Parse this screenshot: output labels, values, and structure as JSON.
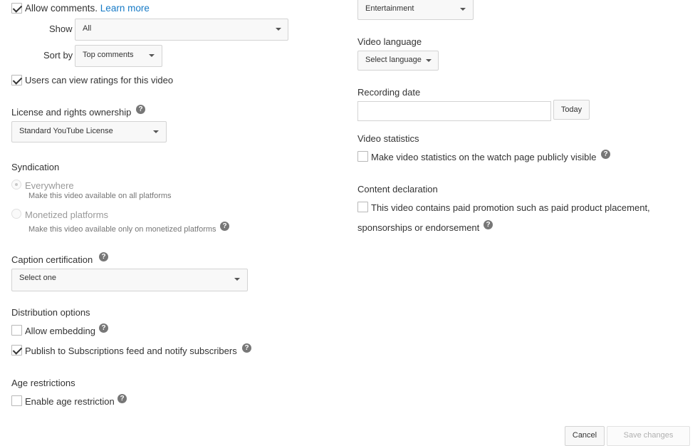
{
  "comments": {
    "allow_label": "Allow comments.",
    "learn_more": "Learn more",
    "show_label": "Show",
    "show_value": "All",
    "sort_label": "Sort by",
    "sort_value": "Top comments"
  },
  "ratings": {
    "label": "Users can view ratings for this video"
  },
  "license": {
    "heading": "License and rights ownership",
    "value": "Standard YouTube License"
  },
  "syndication": {
    "heading": "Syndication",
    "everywhere_label": "Everywhere",
    "everywhere_desc": "Make this video available on all platforms",
    "monetized_label": "Monetized platforms",
    "monetized_desc": "Make this video available only on monetized platforms"
  },
  "caption": {
    "heading": "Caption certification",
    "value": "Select one"
  },
  "distribution": {
    "heading": "Distribution options",
    "embedding_label": "Allow embedding",
    "publish_label": "Publish to Subscriptions feed and notify subscribers"
  },
  "age": {
    "heading": "Age restrictions",
    "label": "Enable age restriction"
  },
  "category": {
    "value": "Entertainment"
  },
  "video_language": {
    "heading": "Video language",
    "value": "Select language"
  },
  "recording_date": {
    "heading": "Recording date",
    "value": "",
    "today_button": "Today"
  },
  "video_statistics": {
    "heading": "Video statistics",
    "label": "Make video statistics on the watch page publicly visible"
  },
  "content_declaration": {
    "heading": "Content declaration",
    "label_line1": "This video contains paid promotion such as paid product placement,",
    "label_line2": "sponsorships or endorsement"
  },
  "footer": {
    "cancel": "Cancel",
    "save": "Save changes"
  },
  "icons": {
    "help": "?",
    "checkbox": "checkmark-icon",
    "dropdown": "caret-down-icon"
  },
  "colors": {
    "link": "#167ac6",
    "text": "#333333",
    "muted": "#767676",
    "help_icon": "#777777"
  }
}
